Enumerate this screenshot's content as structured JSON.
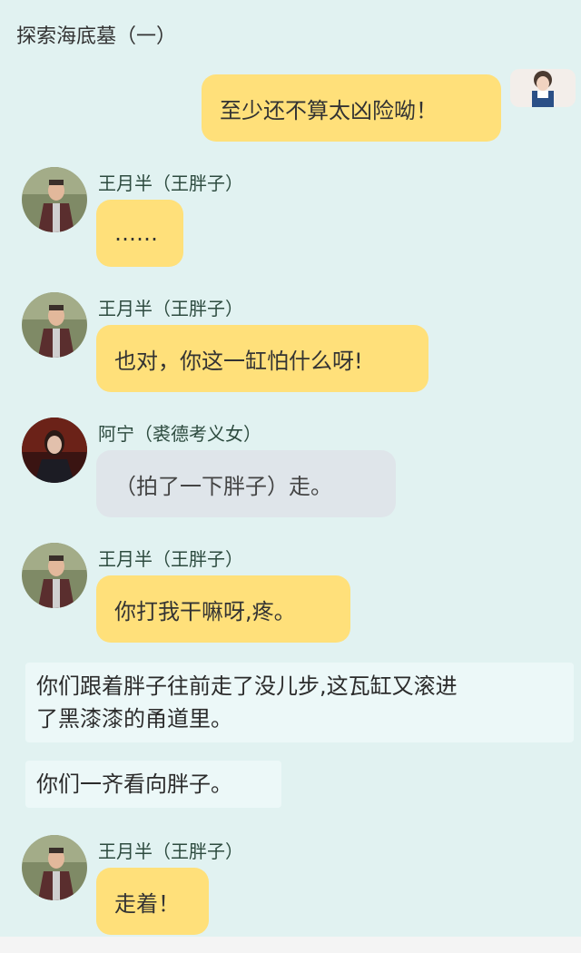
{
  "header": {
    "title": "探索海底墓（一）"
  },
  "messages": [
    {
      "speaker": "",
      "text": "至少还不算太凶险呦！",
      "side": "right"
    },
    {
      "speaker": "王月半（王胖子）",
      "text": "……",
      "side": "left"
    },
    {
      "speaker": "王月半（王胖子）",
      "text": "也对，你这一缸怕什么呀!",
      "side": "left"
    },
    {
      "speaker": "阿宁（裘德考义女）",
      "text": "（拍了一下胖子）走。",
      "side": "left"
    },
    {
      "speaker": "王月半（王胖子）",
      "text": "你打我干嘛呀,疼。",
      "side": "left"
    }
  ],
  "narration": [
    {
      "line1": "你们跟着胖子往前走了没儿步,这瓦缸又滚进",
      "line2": "了黑漆漆的甬道里。"
    },
    {
      "line1": "你们一齐看向胖子。"
    }
  ],
  "last_message": {
    "speaker": "王月半（王胖子）",
    "text": "走着！"
  },
  "colors": {
    "background": "#e1f2f1",
    "bubble_yellow": "#ffe07a",
    "bubble_gray": "#dfe5ea"
  }
}
